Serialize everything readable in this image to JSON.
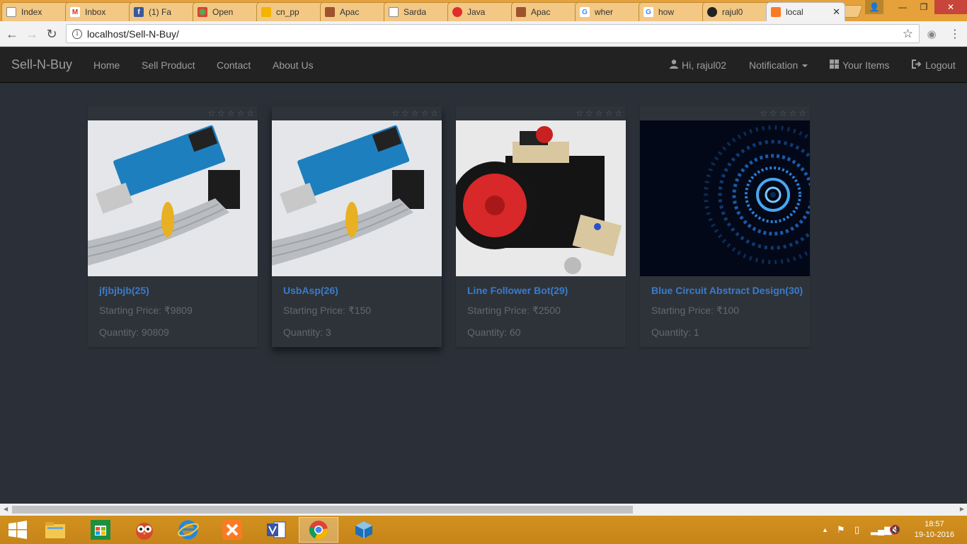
{
  "browser": {
    "tabs": [
      {
        "label": "Index",
        "icon": "page-icon"
      },
      {
        "label": "Inbox",
        "icon": "gmail-icon"
      },
      {
        "label": "(1) Fa",
        "icon": "facebook-icon"
      },
      {
        "label": "Open",
        "icon": "openhub-icon"
      },
      {
        "label": "cn_pp",
        "icon": "slides-icon"
      },
      {
        "label": "Apac",
        "icon": "apache-icon"
      },
      {
        "label": "Sarda",
        "icon": "page-icon"
      },
      {
        "label": "Java",
        "icon": "oracle-icon"
      },
      {
        "label": "Apac",
        "icon": "apache-icon"
      },
      {
        "label": "wher",
        "icon": "google-icon"
      },
      {
        "label": "how",
        "icon": "google-icon"
      },
      {
        "label": "rajul0",
        "icon": "github-icon"
      },
      {
        "label": "local",
        "icon": "xampp-icon"
      }
    ],
    "url": "localhost/Sell-N-Buy/"
  },
  "site": {
    "brand": "Sell-N-Buy",
    "nav": {
      "home": "Home",
      "sell": "Sell Product",
      "contact": "Contact",
      "about": "About Us",
      "greeting": "Hi, rajul02",
      "notification": "Notification",
      "your_items": "Your Items",
      "logout": "Logout"
    }
  },
  "products": [
    {
      "title": "jfjbjbjb(25)",
      "price": "Starting Price: ₹9809",
      "quantity": "Quantity: 90809",
      "rating_stars": "☆☆☆☆☆",
      "image": "usbasp-programmer-image"
    },
    {
      "title": "UsbAsp(26)",
      "price": "Starting Price: ₹150",
      "quantity": "Quantity: 3",
      "rating_stars": "☆☆☆☆☆",
      "image": "usbasp-programmer-image"
    },
    {
      "title": "Line Follower Bot(29)",
      "price": "Starting Price: ₹2500",
      "quantity": "Quantity: 60",
      "rating_stars": "☆☆☆☆☆",
      "image": "robot-image"
    },
    {
      "title": "Blue Circuit Abstract Design(30)",
      "price": "Starting Price: ₹100",
      "quantity": "Quantity: 1",
      "rating_stars": "☆☆☆☆☆",
      "image": "blue-circuit-image"
    }
  ],
  "taskbar": {
    "time": "18:57",
    "date": "19-10-2016"
  },
  "colors": {
    "page_bg": "#2b3038",
    "navbar_bg": "#222222",
    "card_bg": "#2e333a",
    "title_link": "#3a7bc8",
    "muted_text": "#626870",
    "taskbar": "#c6841a"
  }
}
